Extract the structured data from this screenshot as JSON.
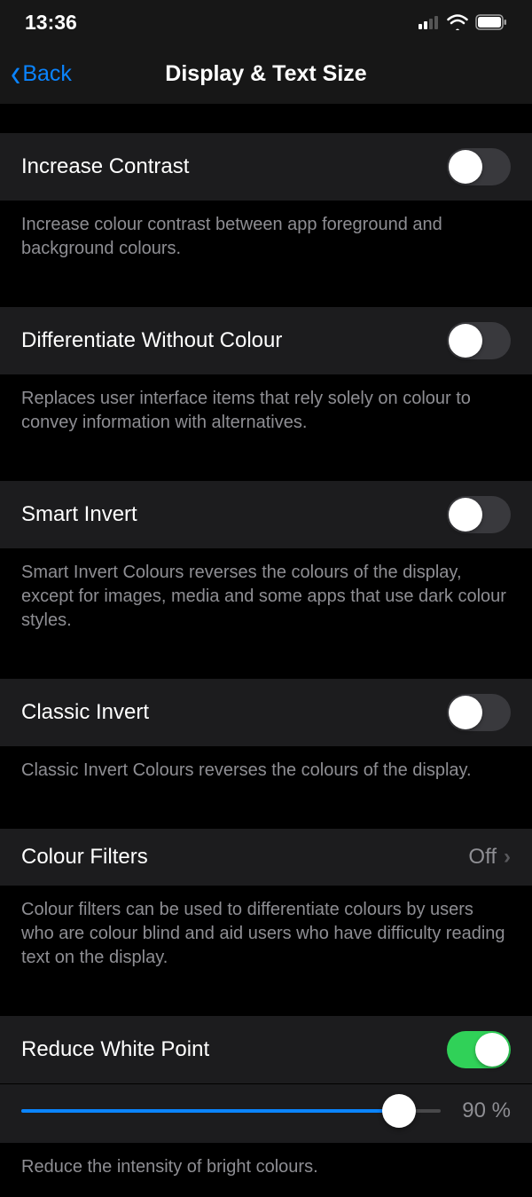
{
  "status": {
    "time": "13:36"
  },
  "nav": {
    "back": "Back",
    "title": "Display & Text Size"
  },
  "settings": {
    "increase_contrast": {
      "label": "Increase Contrast",
      "desc": "Increase colour contrast between app foreground and background colours.",
      "on": false
    },
    "differentiate": {
      "label": "Differentiate Without Colour",
      "desc": "Replaces user interface items that rely solely on colour to convey information with alternatives.",
      "on": false
    },
    "smart_invert": {
      "label": "Smart Invert",
      "desc": "Smart Invert Colours reverses the colours of the display, except for images, media and some apps that use dark colour styles.",
      "on": false
    },
    "classic_invert": {
      "label": "Classic Invert",
      "desc": "Classic Invert Colours reverses the colours of the display.",
      "on": false
    },
    "colour_filters": {
      "label": "Colour Filters",
      "value": "Off",
      "desc": "Colour filters can be used to differentiate colours by users who are colour blind and aid users who have difficulty reading text on the display."
    },
    "reduce_white_point": {
      "label": "Reduce White Point",
      "on": true,
      "slider_percent": 90,
      "slider_display": "90 %",
      "desc": "Reduce the intensity of bright colours."
    }
  }
}
